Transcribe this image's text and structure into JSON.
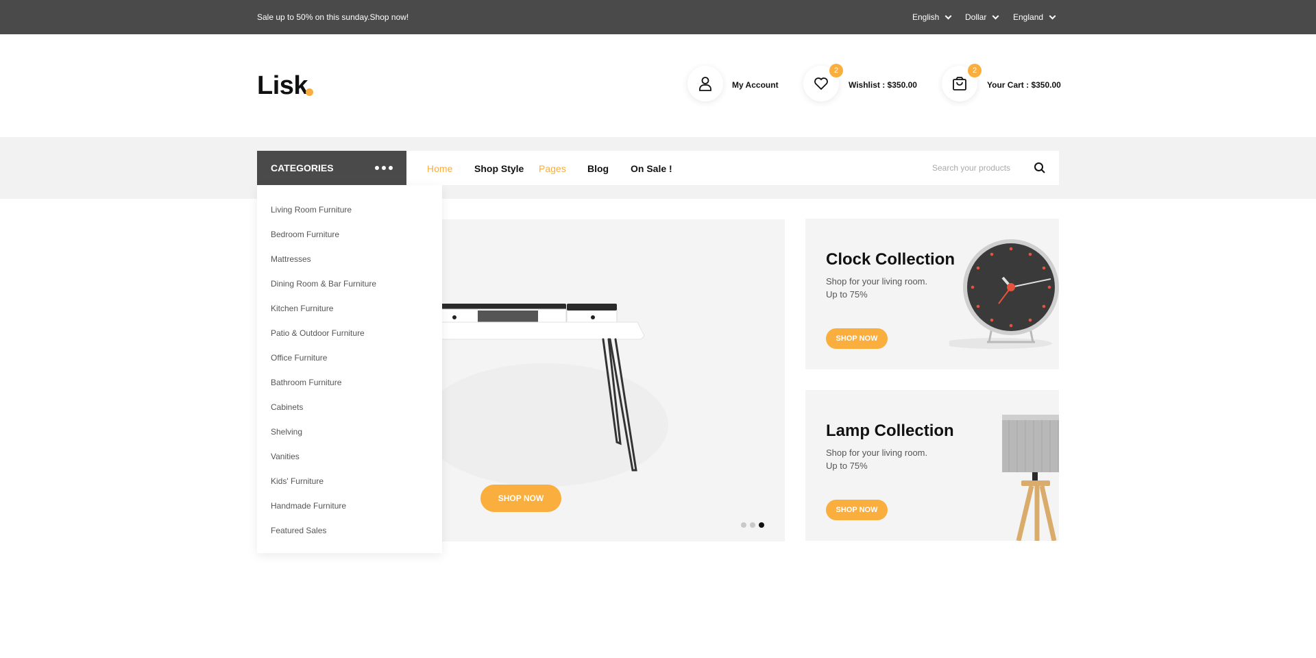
{
  "topbar": {
    "promo": "Sale up to 50% on this sunday.Shop now!",
    "language": "English",
    "currency": "Dollar",
    "country": "England"
  },
  "header": {
    "logo": "Lisk",
    "account_label": "My Account",
    "wishlist_count": "2",
    "wishlist_label": "Wishlist : $350.00",
    "cart_count": "2",
    "cart_label": "Your Cart : $350.00"
  },
  "nav": {
    "categories_label": "CATEGORIES",
    "links": [
      "Home",
      "Shop Style",
      "Pages",
      "Blog",
      "On Sale !"
    ],
    "search_placeholder": "Search your products"
  },
  "categories": [
    "Living Room Furniture",
    "Bedroom Furniture",
    "Mattresses",
    "Dining Room & Bar Furniture",
    "Kitchen Furniture",
    "Patio & Outdoor Furniture",
    "Office Furniture",
    "Bathroom Furniture",
    "Cabinets",
    "Shelving",
    "Vanities",
    "Kids' Furniture",
    "Handmade Furniture",
    "Featured Sales"
  ],
  "hero": {
    "button": "SHOP NOW",
    "slides_total": 3,
    "active_slide": 3
  },
  "banners": [
    {
      "title": "Clock Collection",
      "line1": "Shop for your living room.",
      "line2": "Up to 75%",
      "button": "SHOP NOW"
    },
    {
      "title": "Lamp Collection",
      "line1": "Shop for your living room.",
      "line2": "Up to 75%",
      "button": "SHOP NOW"
    }
  ],
  "colors": {
    "accent": "#f9ae3d",
    "dark": "#4a4a4a",
    "panel": "#f4f4f4"
  }
}
